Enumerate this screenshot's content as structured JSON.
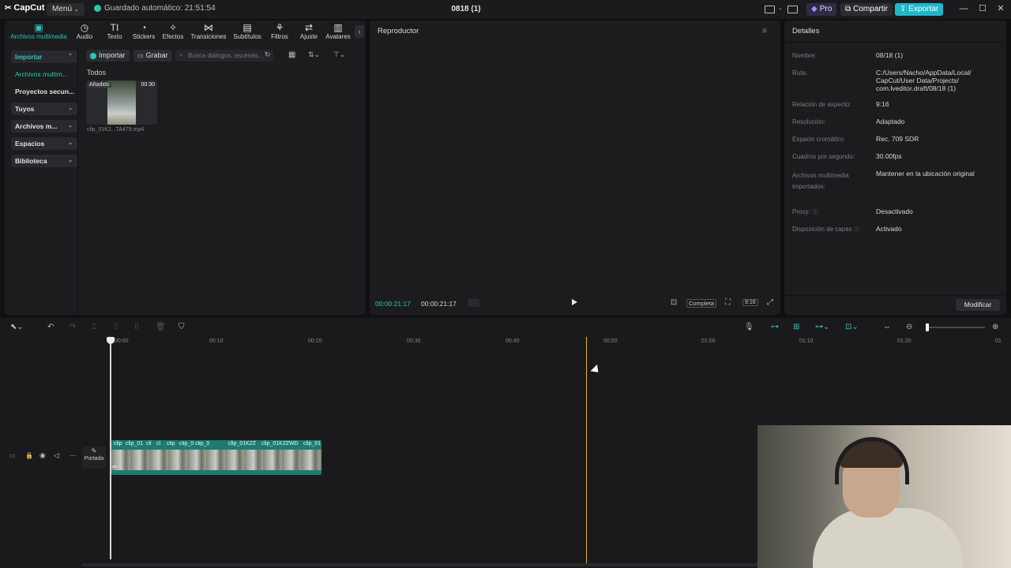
{
  "app": {
    "logo_text": "CapCut",
    "menu_label": "Menú",
    "autosave_text": "Guardado automático: 21:51:54",
    "project_title": "0818 (1)",
    "pro_label": "Pro",
    "share_label": "Compartir",
    "export_label": "Exportar"
  },
  "colors": {
    "accent": "#29c7b6",
    "export_bg": "#1fb7c9",
    "playhead": "#e8b42a",
    "clip": "#1f7a70"
  },
  "toolbar": {
    "tabs": [
      {
        "label": "Archivos multimedia",
        "icon": "media-icon",
        "glyph": "▣"
      },
      {
        "label": "Audio",
        "icon": "audio-icon",
        "glyph": "◷"
      },
      {
        "label": "Texto",
        "icon": "text-icon",
        "glyph": "TI"
      },
      {
        "label": "Stickers",
        "icon": "sticker-icon",
        "glyph": "◔"
      },
      {
        "label": "Efectos",
        "icon": "effects-icon",
        "glyph": "✧"
      },
      {
        "label": "Transiciones",
        "icon": "transition-icon",
        "glyph": "⋈"
      },
      {
        "label": "Subtítulos",
        "icon": "subtitles-icon",
        "glyph": "▤"
      },
      {
        "label": "Filtros",
        "icon": "filters-icon",
        "glyph": "⚘"
      },
      {
        "label": "Ajuste",
        "icon": "adjust-icon",
        "glyph": "⇄"
      },
      {
        "label": "Avatares",
        "icon": "avatar-icon",
        "glyph": "▥"
      }
    ]
  },
  "sidebar": {
    "items": [
      {
        "label": "Importar",
        "chev": "⌃"
      },
      {
        "label": "Archivos multim...",
        "chev": ""
      },
      {
        "label": "Proyectos secun...",
        "chev": ""
      },
      {
        "label": "Tuyos",
        "chev": "⌄"
      },
      {
        "label": "Archivos m...",
        "chev": "⌄"
      },
      {
        "label": "Espacios",
        "chev": "⌄"
      },
      {
        "label": "Biblioteca",
        "chev": "⌄"
      }
    ]
  },
  "media": {
    "import_label": "Importar",
    "record_label": "Grabar",
    "search_placeholder": "Busca diálogos, escenas...",
    "section_label": "Todos",
    "items": [
      {
        "badge": "Añadido",
        "duration": "00:30",
        "filename": "clip_01K2...TA479.mp4"
      }
    ]
  },
  "player": {
    "title": "Reproductor",
    "current_time": "00:00:21:17",
    "total_time": "00:00:21:17",
    "complete_label": "Completa",
    "ratio_label": "9:16"
  },
  "details": {
    "title": "Detalles",
    "rows": [
      {
        "label": "Nombre:",
        "value": "08/18 (1)"
      },
      {
        "label": "Ruta:",
        "value": "C:/Users/Nacho/AppData/Local/ CapCut/User Data/Projects/ com.lveditor.draft/08/18 (1)"
      },
      {
        "label": "Relación de aspecto:",
        "value": "9:16"
      },
      {
        "label": "Resolución:",
        "value": "Adaptado"
      },
      {
        "label": "Espacio cromático",
        "value": "Rec. 709 SDR"
      },
      {
        "label": "Cuadros por segundo:",
        "value": "30.00fps"
      },
      {
        "label": "Archivos multimedia importados:",
        "value": "Mantener en la ubicación original"
      },
      {
        "label": "Proxy:",
        "value": "Desactivado"
      },
      {
        "label": "Disposición de capas",
        "value": "Activado"
      }
    ],
    "modify_label": "Modificar"
  },
  "timeline": {
    "ruler": [
      "00:00",
      "00:10",
      "00:20",
      "00:30",
      "00:40",
      "00:50",
      "01:00",
      "01:10",
      "01:20",
      "01"
    ],
    "cover_label": "Portada",
    "clips": [
      "clip",
      "clip_01",
      "cli",
      "cl",
      "clip",
      "clip_0",
      "clip_0",
      "clip_01K2Z",
      "clip_01K2ZWD",
      "clip_01"
    ]
  }
}
